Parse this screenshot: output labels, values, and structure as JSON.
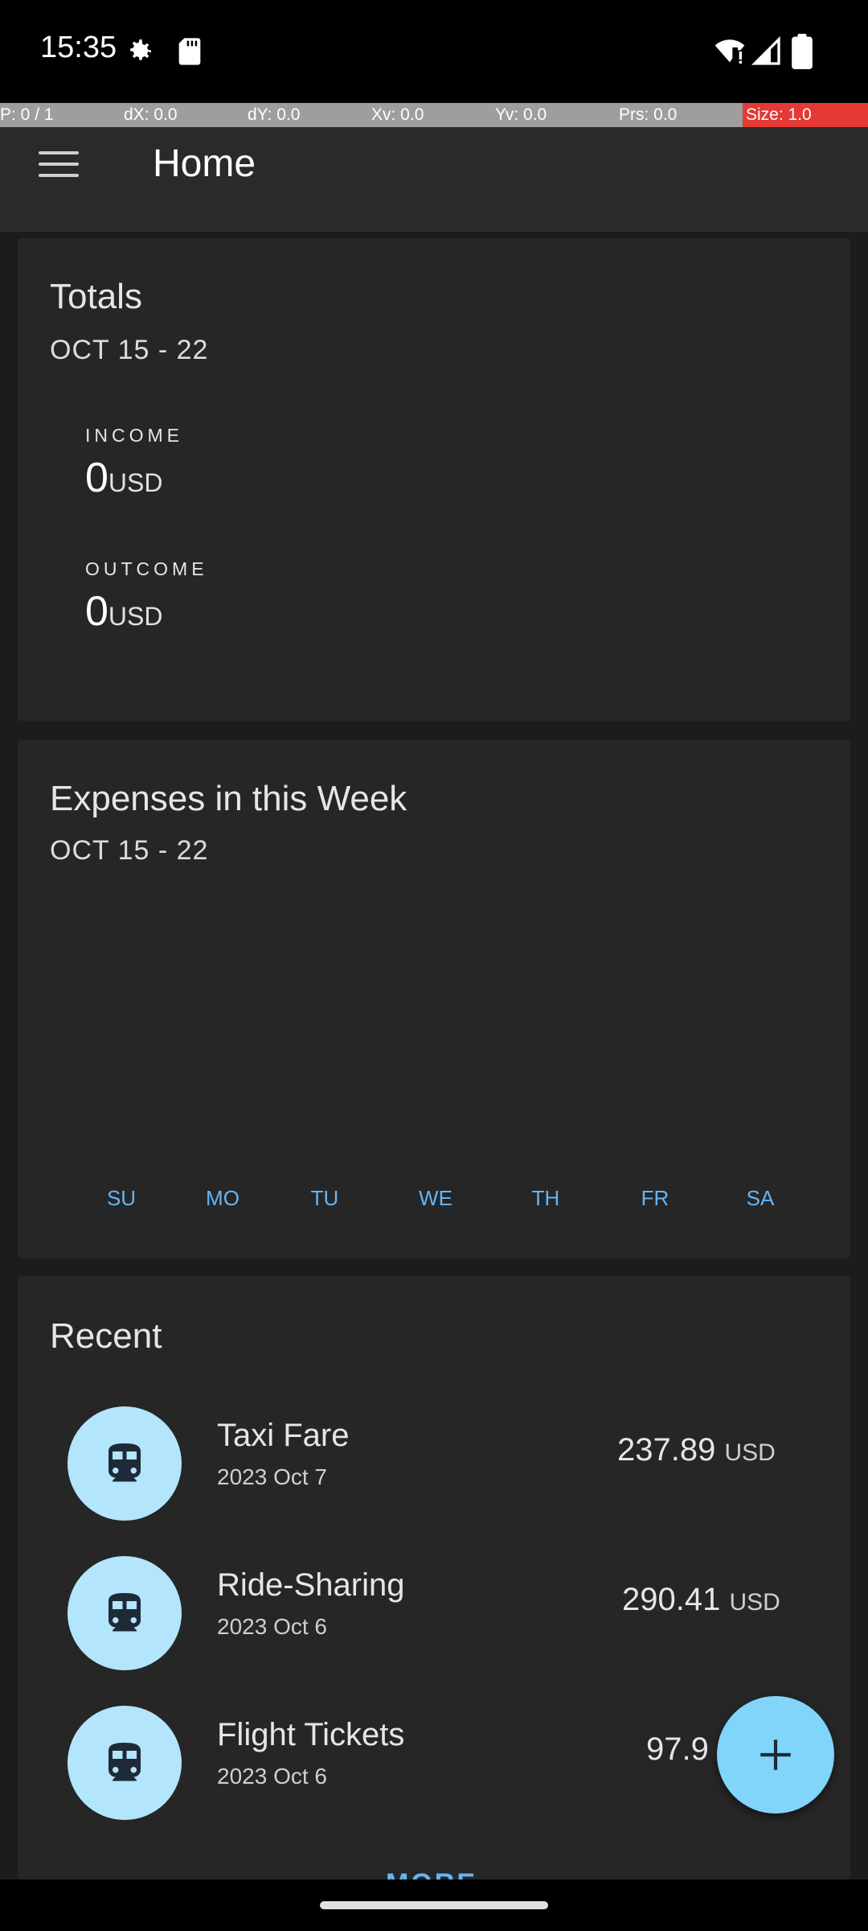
{
  "status_bar": {
    "time": "15:35",
    "icons": [
      "gear-icon",
      "sd-card-icon",
      "wifi-alert-icon",
      "cell-signal-icon",
      "battery-icon"
    ]
  },
  "debug_bar": {
    "pointer": "P: 0 / 1",
    "dx": "dX: 0.0",
    "dy": "dY: 0.0",
    "xv": "Xv: 0.0",
    "yv": "Yv: 0.0",
    "prs": "Prs: 0.0",
    "size": "Size: 1.0"
  },
  "app_bar": {
    "title": "Home",
    "menu_icon": "hamburger-menu-icon"
  },
  "totals": {
    "title": "Totals",
    "range": "OCT 15 - 22",
    "income_label": "INCOME",
    "income_value": "0",
    "income_currency": "USD",
    "outcome_label": "OUTCOME",
    "outcome_value": "0",
    "outcome_currency": "USD"
  },
  "weekly": {
    "title": "Expenses in this Week",
    "range": "OCT 15 - 22",
    "days": [
      "SU",
      "MO",
      "TU",
      "WE",
      "TH",
      "FR",
      "SA"
    ]
  },
  "recent": {
    "title": "Recent",
    "items": [
      {
        "name": "Taxi Fare",
        "date": "2023 Oct 7",
        "amount": "237.89",
        "currency": "USD",
        "icon": "train-icon"
      },
      {
        "name": "Ride-Sharing",
        "date": "2023 Oct 6",
        "amount": "290.41",
        "currency": "USD",
        "icon": "train-icon"
      },
      {
        "name": "Flight Tickets",
        "date": "2023 Oct 6",
        "amount": "97.9",
        "currency": "",
        "icon": "train-icon"
      }
    ],
    "more_label": "MORE"
  },
  "fab": {
    "icon": "plus-icon"
  },
  "colors": {
    "accent": "#64b5f6",
    "avatar_bg": "#b3e5fc",
    "fab_bg": "#81d4fa",
    "card_bg": "#262626",
    "page_bg": "#1c1c1c"
  }
}
